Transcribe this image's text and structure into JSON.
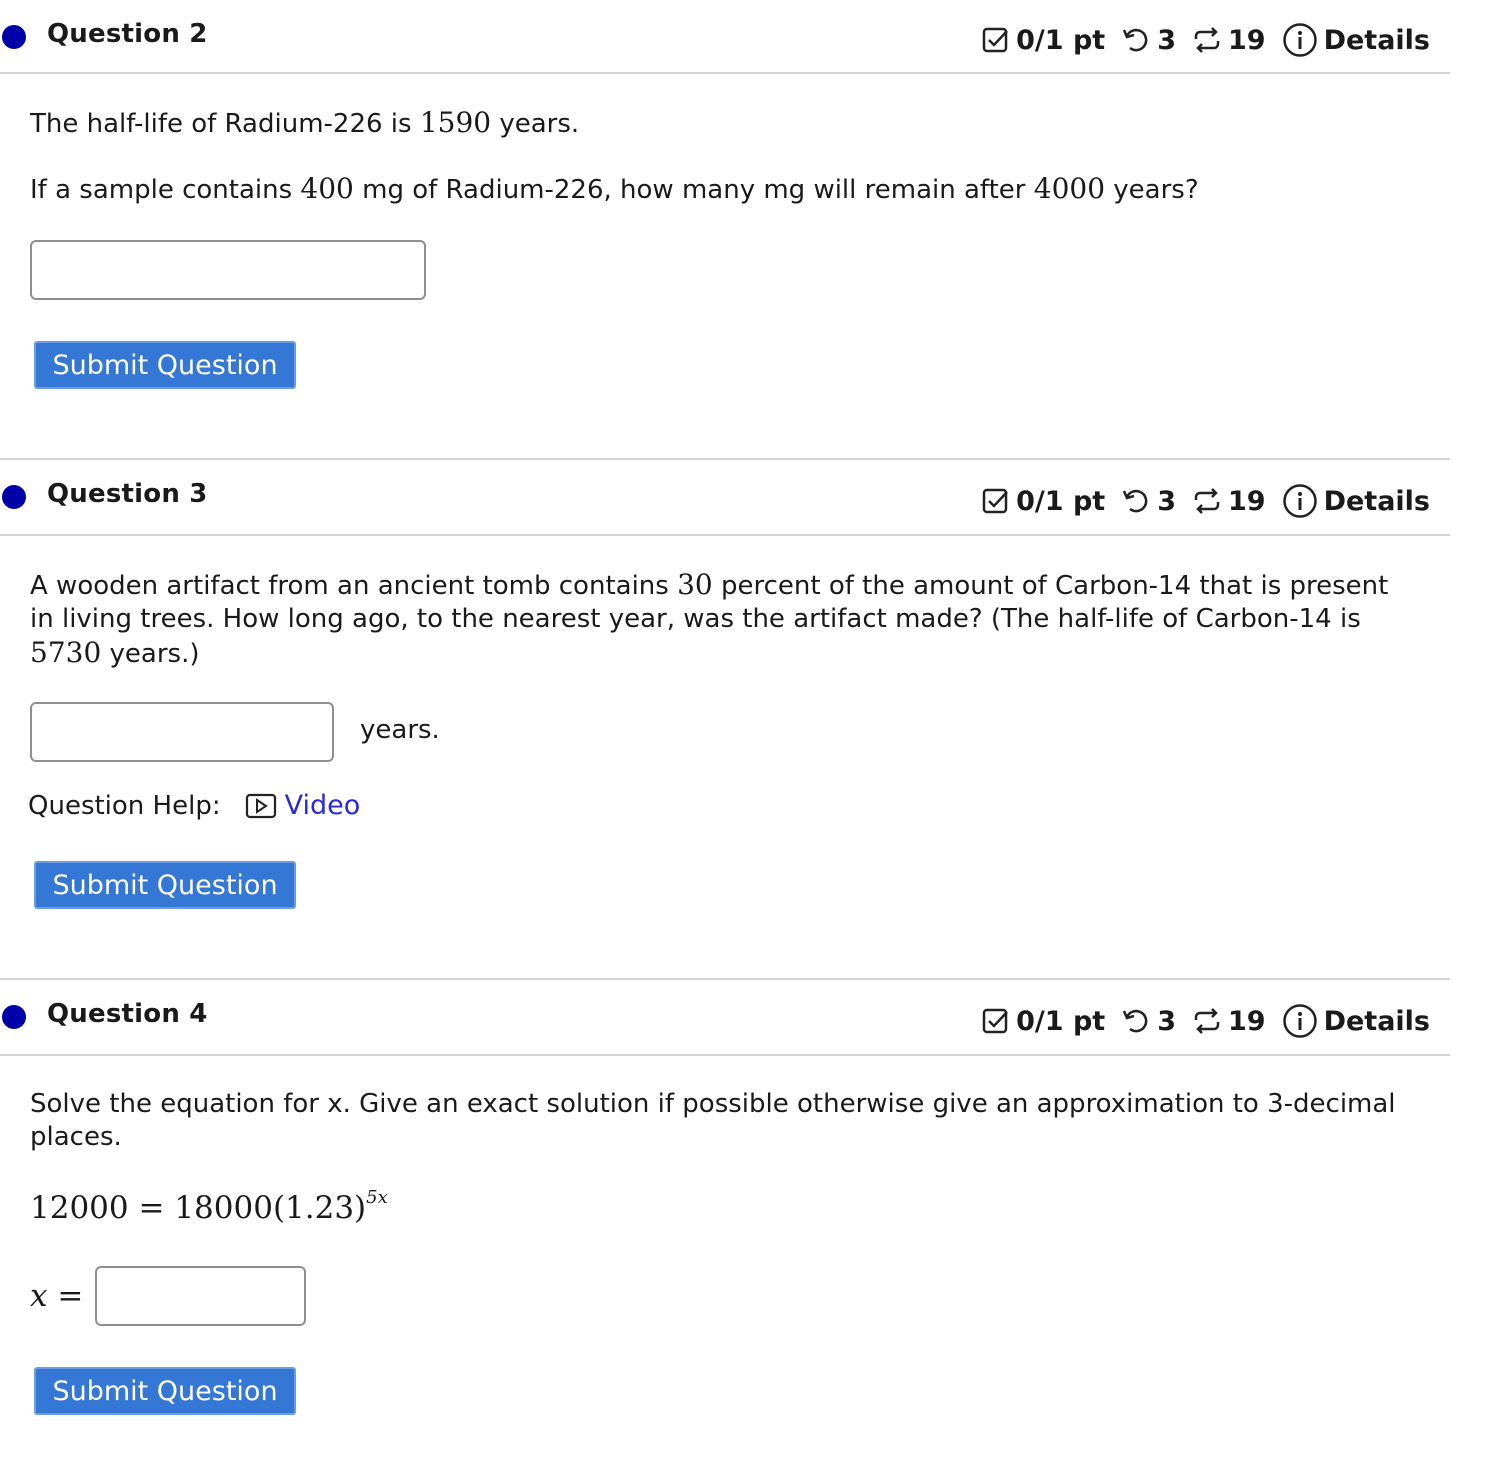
{
  "meta": {
    "score": "0/1 pt",
    "retries": "3",
    "attempts": "19",
    "details": "Details"
  },
  "q2": {
    "title": "Question 2",
    "line1_prefix": "The half-life of Radium-226 is ",
    "line1_num": "1590",
    "line1_suffix": " years.",
    "line2_a": "If a sample contains ",
    "line2_num1": "400",
    "line2_b": " mg of Radium-226, how many mg will remain after ",
    "line2_num2": "4000",
    "line2_c": " years?",
    "submit": "Submit Question"
  },
  "q3": {
    "title": "Question 3",
    "text_a": "A wooden artifact from an ancient tomb contains ",
    "text_num1": "30",
    "text_b": " percent of the amount of Carbon-14 that is present in living trees. How long ago, to the nearest year, was the artifact made? (The half-life of Carbon-14 is ",
    "text_num2": "5730",
    "text_c": " years.)",
    "unit": "years.",
    "help_label": "Question Help:",
    "video_label": "Video",
    "submit": "Submit Question"
  },
  "q4": {
    "title": "Question 4",
    "text": "Solve the equation for x. Give an exact solution if possible otherwise give an approximation to 3-decimal places.",
    "eq_lhs": "12000",
    "eq_rhs": "18000(1.23)",
    "eq_exp": "5x",
    "x_label": "x",
    "submit": "Submit Question"
  }
}
